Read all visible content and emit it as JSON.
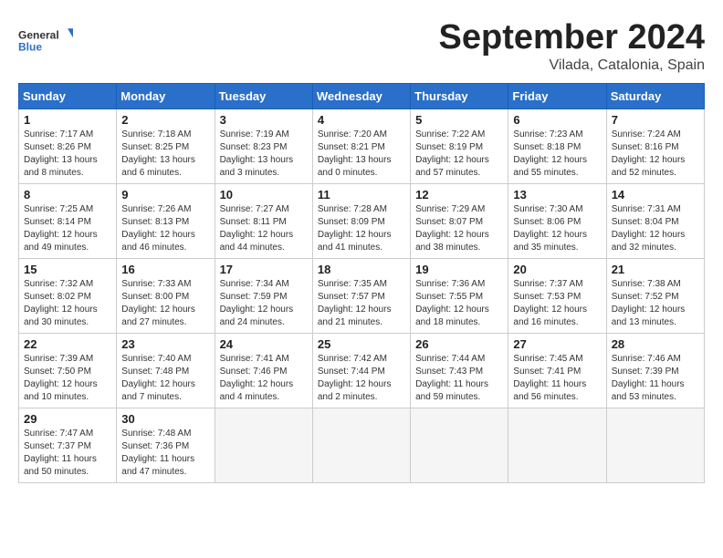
{
  "header": {
    "logo_general": "General",
    "logo_blue": "Blue",
    "month_title": "September 2024",
    "location": "Vilada, Catalonia, Spain"
  },
  "days_of_week": [
    "Sunday",
    "Monday",
    "Tuesday",
    "Wednesday",
    "Thursday",
    "Friday",
    "Saturday"
  ],
  "weeks": [
    [
      {
        "day": 1,
        "lines": [
          "Sunrise: 7:17 AM",
          "Sunset: 8:26 PM",
          "Daylight: 13 hours",
          "and 8 minutes."
        ]
      },
      {
        "day": 2,
        "lines": [
          "Sunrise: 7:18 AM",
          "Sunset: 8:25 PM",
          "Daylight: 13 hours",
          "and 6 minutes."
        ]
      },
      {
        "day": 3,
        "lines": [
          "Sunrise: 7:19 AM",
          "Sunset: 8:23 PM",
          "Daylight: 13 hours",
          "and 3 minutes."
        ]
      },
      {
        "day": 4,
        "lines": [
          "Sunrise: 7:20 AM",
          "Sunset: 8:21 PM",
          "Daylight: 13 hours",
          "and 0 minutes."
        ]
      },
      {
        "day": 5,
        "lines": [
          "Sunrise: 7:22 AM",
          "Sunset: 8:19 PM",
          "Daylight: 12 hours",
          "and 57 minutes."
        ]
      },
      {
        "day": 6,
        "lines": [
          "Sunrise: 7:23 AM",
          "Sunset: 8:18 PM",
          "Daylight: 12 hours",
          "and 55 minutes."
        ]
      },
      {
        "day": 7,
        "lines": [
          "Sunrise: 7:24 AM",
          "Sunset: 8:16 PM",
          "Daylight: 12 hours",
          "and 52 minutes."
        ]
      }
    ],
    [
      {
        "day": 8,
        "lines": [
          "Sunrise: 7:25 AM",
          "Sunset: 8:14 PM",
          "Daylight: 12 hours",
          "and 49 minutes."
        ]
      },
      {
        "day": 9,
        "lines": [
          "Sunrise: 7:26 AM",
          "Sunset: 8:13 PM",
          "Daylight: 12 hours",
          "and 46 minutes."
        ]
      },
      {
        "day": 10,
        "lines": [
          "Sunrise: 7:27 AM",
          "Sunset: 8:11 PM",
          "Daylight: 12 hours",
          "and 44 minutes."
        ]
      },
      {
        "day": 11,
        "lines": [
          "Sunrise: 7:28 AM",
          "Sunset: 8:09 PM",
          "Daylight: 12 hours",
          "and 41 minutes."
        ]
      },
      {
        "day": 12,
        "lines": [
          "Sunrise: 7:29 AM",
          "Sunset: 8:07 PM",
          "Daylight: 12 hours",
          "and 38 minutes."
        ]
      },
      {
        "day": 13,
        "lines": [
          "Sunrise: 7:30 AM",
          "Sunset: 8:06 PM",
          "Daylight: 12 hours",
          "and 35 minutes."
        ]
      },
      {
        "day": 14,
        "lines": [
          "Sunrise: 7:31 AM",
          "Sunset: 8:04 PM",
          "Daylight: 12 hours",
          "and 32 minutes."
        ]
      }
    ],
    [
      {
        "day": 15,
        "lines": [
          "Sunrise: 7:32 AM",
          "Sunset: 8:02 PM",
          "Daylight: 12 hours",
          "and 30 minutes."
        ]
      },
      {
        "day": 16,
        "lines": [
          "Sunrise: 7:33 AM",
          "Sunset: 8:00 PM",
          "Daylight: 12 hours",
          "and 27 minutes."
        ]
      },
      {
        "day": 17,
        "lines": [
          "Sunrise: 7:34 AM",
          "Sunset: 7:59 PM",
          "Daylight: 12 hours",
          "and 24 minutes."
        ]
      },
      {
        "day": 18,
        "lines": [
          "Sunrise: 7:35 AM",
          "Sunset: 7:57 PM",
          "Daylight: 12 hours",
          "and 21 minutes."
        ]
      },
      {
        "day": 19,
        "lines": [
          "Sunrise: 7:36 AM",
          "Sunset: 7:55 PM",
          "Daylight: 12 hours",
          "and 18 minutes."
        ]
      },
      {
        "day": 20,
        "lines": [
          "Sunrise: 7:37 AM",
          "Sunset: 7:53 PM",
          "Daylight: 12 hours",
          "and 16 minutes."
        ]
      },
      {
        "day": 21,
        "lines": [
          "Sunrise: 7:38 AM",
          "Sunset: 7:52 PM",
          "Daylight: 12 hours",
          "and 13 minutes."
        ]
      }
    ],
    [
      {
        "day": 22,
        "lines": [
          "Sunrise: 7:39 AM",
          "Sunset: 7:50 PM",
          "Daylight: 12 hours",
          "and 10 minutes."
        ]
      },
      {
        "day": 23,
        "lines": [
          "Sunrise: 7:40 AM",
          "Sunset: 7:48 PM",
          "Daylight: 12 hours",
          "and 7 minutes."
        ]
      },
      {
        "day": 24,
        "lines": [
          "Sunrise: 7:41 AM",
          "Sunset: 7:46 PM",
          "Daylight: 12 hours",
          "and 4 minutes."
        ]
      },
      {
        "day": 25,
        "lines": [
          "Sunrise: 7:42 AM",
          "Sunset: 7:44 PM",
          "Daylight: 12 hours",
          "and 2 minutes."
        ]
      },
      {
        "day": 26,
        "lines": [
          "Sunrise: 7:44 AM",
          "Sunset: 7:43 PM",
          "Daylight: 11 hours",
          "and 59 minutes."
        ]
      },
      {
        "day": 27,
        "lines": [
          "Sunrise: 7:45 AM",
          "Sunset: 7:41 PM",
          "Daylight: 11 hours",
          "and 56 minutes."
        ]
      },
      {
        "day": 28,
        "lines": [
          "Sunrise: 7:46 AM",
          "Sunset: 7:39 PM",
          "Daylight: 11 hours",
          "and 53 minutes."
        ]
      }
    ],
    [
      {
        "day": 29,
        "lines": [
          "Sunrise: 7:47 AM",
          "Sunset: 7:37 PM",
          "Daylight: 11 hours",
          "and 50 minutes."
        ]
      },
      {
        "day": 30,
        "lines": [
          "Sunrise: 7:48 AM",
          "Sunset: 7:36 PM",
          "Daylight: 11 hours",
          "and 47 minutes."
        ]
      },
      {
        "day": null,
        "lines": []
      },
      {
        "day": null,
        "lines": []
      },
      {
        "day": null,
        "lines": []
      },
      {
        "day": null,
        "lines": []
      },
      {
        "day": null,
        "lines": []
      }
    ]
  ]
}
